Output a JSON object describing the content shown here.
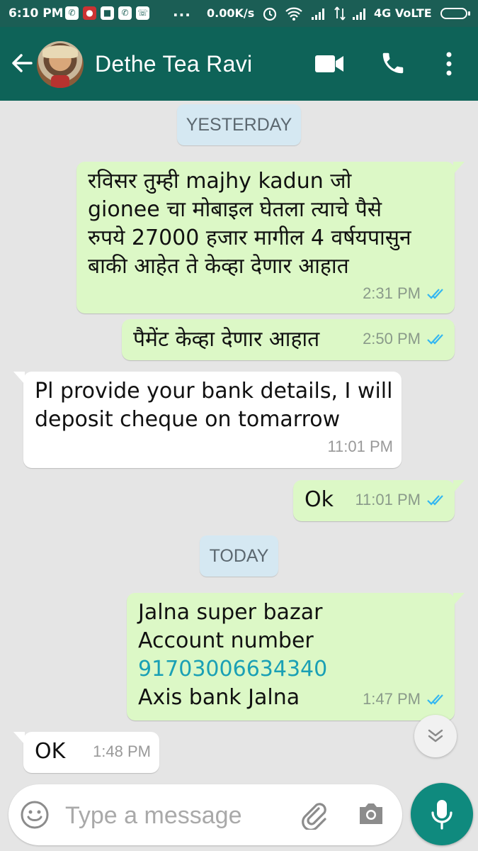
{
  "status_bar": {
    "time": "6:10 PM",
    "more_indicator": "...",
    "net_speed": "0.00K/s",
    "network": "4G VoLTE"
  },
  "header": {
    "contact_name": "Dethe Tea Ravi"
  },
  "dates": {
    "yesterday": "YESTERDAY",
    "today": "TODAY"
  },
  "messages": [
    {
      "direction": "out",
      "lines": [
        "रविसर तुम्ही majhy kadun जो",
        "gionee चा मोबाइल घेतला त्याचे पैसे",
        "रुपये 27000 हजार मागील 4 वर्षयपासुन",
        "बाकी आहेत ते केव्हा देणार आहात"
      ],
      "time": "2:31 PM",
      "read": true
    },
    {
      "direction": "out",
      "lines": [
        "पैमेंट केव्हा देणार आहात"
      ],
      "time": "2:50 PM",
      "read": true
    },
    {
      "direction": "in",
      "lines": [
        "Pl provide your bank details, I will",
        "deposit cheque on tomarrow"
      ],
      "time": "11:01 PM"
    },
    {
      "direction": "out",
      "lines": [
        "Ok"
      ],
      "time": "11:01 PM",
      "read": true
    },
    {
      "direction": "out",
      "lines": [
        "Jalna super bazar",
        "Account number",
        "91703006634340",
        "Axis bank Jalna"
      ],
      "time": "1:47 PM",
      "read": true
    },
    {
      "direction": "in",
      "lines": [
        "OK"
      ],
      "time": "1:48 PM"
    }
  ],
  "composer": {
    "placeholder": "Type a message"
  },
  "colors": {
    "header": "#0e6358",
    "outgoing_bubble": "#dcf8c6",
    "incoming_bubble": "#ffffff",
    "read_tick": "#34b7f1",
    "mic_button": "#0f8a7e"
  },
  "icons": [
    "back-arrow-icon",
    "video-call-icon",
    "phone-icon",
    "more-vert-icon",
    "emoji-icon",
    "attach-icon",
    "camera-icon",
    "mic-icon",
    "chevron-down-icon",
    "double-tick-icon"
  ]
}
